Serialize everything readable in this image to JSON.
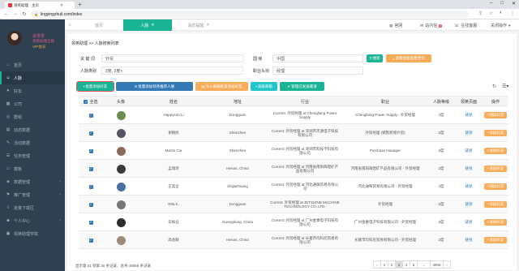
{
  "browser": {
    "tab_title": "领英助理 - 主页",
    "url": "lingyingzhuli.com/index",
    "new_tab": "+",
    "nav": {
      "back": "←",
      "forward": "→",
      "reload": "↻"
    },
    "window_buttons": [
      "–",
      "□",
      "✕"
    ]
  },
  "profile": {
    "name": "肖零零",
    "role": "领英助理全能",
    "vip": "VIP会员"
  },
  "sidebar": {
    "items": [
      {
        "label": "首页",
        "icon": "home-icon",
        "glyph": "⌂",
        "active": false,
        "arrow": false
      },
      {
        "label": "人脉",
        "icon": "people-icon",
        "glyph": "☺",
        "active": true,
        "arrow": false
      },
      {
        "label": "好友",
        "icon": "friend-icon",
        "glyph": "♥",
        "active": false,
        "arrow": false
      },
      {
        "label": "公司",
        "icon": "company-icon",
        "glyph": "▦",
        "active": false,
        "arrow": false
      },
      {
        "label": "群组",
        "icon": "group-icon",
        "glyph": "◎",
        "active": false,
        "arrow": false
      },
      {
        "label": "动态数据",
        "icon": "chart-icon",
        "glyph": "▤",
        "active": false,
        "arrow": false
      },
      {
        "label": "活动数据",
        "icon": "activity-icon",
        "glyph": "✎",
        "active": false,
        "arrow": false
      },
      {
        "label": "任务管理",
        "icon": "task-icon",
        "glyph": "☰",
        "active": false,
        "arrow": false
      },
      {
        "label": "模板",
        "icon": "template-icon",
        "glyph": "▭",
        "active": false,
        "arrow": false
      },
      {
        "label": "数据管理",
        "icon": "data-icon",
        "glyph": "◈",
        "active": false,
        "arrow": true
      },
      {
        "label": "推广管理",
        "icon": "promo-icon",
        "glyph": "⚑",
        "active": false,
        "arrow": true
      },
      {
        "label": "批量下载区",
        "icon": "download-icon",
        "glyph": "⇩",
        "active": false,
        "arrow": false
      },
      {
        "label": "个人中心",
        "icon": "user-icon",
        "glyph": "☻",
        "active": false,
        "arrow": true
      },
      {
        "label": "领英助理学院",
        "icon": "school-icon",
        "glyph": "▣",
        "active": false,
        "arrow": false
      }
    ]
  },
  "apptabs": {
    "left_arrow": "«",
    "home": "首页",
    "active": "人脉",
    "third": "消息提醒"
  },
  "topbar": {
    "website": "官网",
    "notice": "站内信",
    "notice_count": "7",
    "online": "在线客服",
    "more": "关闭操作"
  },
  "breadcrumb": "领英助理 >> 人脉搜索列表",
  "filters": {
    "keyword_label": "关 键 词",
    "keyword_value": "外贸",
    "relation_label": "人脉类别",
    "relation_value": "2度, 3度+",
    "country_label": "国    家",
    "country_value": "中国",
    "title_label": "职业头衔",
    "title_value": "经理",
    "search_btn": "搜索",
    "advanced_btn": "高级搜索查看更多"
  },
  "actions": [
    {
      "label": "批量添加好友",
      "color": "#1ab394",
      "icon": "▪"
    },
    {
      "label": "批量添加领英推荐人脉",
      "color": "#337ab7",
      "icon": "in"
    },
    {
      "label": "导入邮箱批量添加好友",
      "color": "#f8ac59",
      "icon": "▤"
    },
    {
      "label": "高级邮箱",
      "color": "#23c6c8",
      "icon": "▪"
    },
    {
      "label": "管理已发送邀请",
      "color": "#1ab394",
      "icon": "✔"
    }
  ],
  "tools": {
    "refresh": "↻",
    "columns": "☰▾"
  },
  "table": {
    "headers": [
      "全选",
      "头像",
      "姓名",
      "地址",
      "行业",
      "职业",
      "人脉等级",
      "领英页面",
      "操作"
    ],
    "rows": [
      {
        "name": "Happyson Li",
        "addr": "Dongguan",
        "industry": "Current: 外贸经理 at Chengliang Power Supply",
        "job": "Chengliang Power Supply - 外贸经理",
        "level": "2度",
        "page": "链接",
        "op": "添加好友",
        "av": "#6b8e4e"
      },
      {
        "name": "谢钢民",
        "addr": "Shenzhen",
        "industry": "Current: 外贸经理 at 深圳市杰源电子科技有限公司",
        "job": "外贸经理 (销售跨境外贸)",
        "level": "2度",
        "page": "链接",
        "op": "添加好友",
        "av": "#556"
      },
      {
        "name": "Martin Cai",
        "addr": "Shenzhen",
        "industry": "Current: 外贸经理 at 深圳市科技不科技有限公司",
        "job": "Purchase manager",
        "level": "2度",
        "page": "链接",
        "op": "添加好友",
        "av": "#8a6b5a"
      },
      {
        "name": "孟瑞玲",
        "addr": "Henan, China",
        "industry": "Current: 外贸经理 at 河南省南阳辉煌矿产品有限公司",
        "job": "河南省南阳辉煌矿产品有限公司 - 外贸经理",
        "level": "2度",
        "page": "链接",
        "op": "添加好友",
        "av": "#3a3a3a"
      },
      {
        "name": "王奕企",
        "addr": "Shijiazhuang",
        "industry": "Current: 外贸经理 at 河北通晖贸易有限公司",
        "job": "河北通晖贸易有限公司 - 外贸经理",
        "level": "2度",
        "page": "链接",
        "op": "添加好友",
        "av": "#4a6fa5"
      },
      {
        "name": "Rita K.",
        "addr": "Dongguan",
        "industry": "Current: 外贸经理 at JETSHINE MACHINE TECHNOLOGY CO.,LTD.",
        "job": "外贸经理",
        "level": "2度",
        "page": "链接",
        "op": "添加好友",
        "av": "#777"
      },
      {
        "name": "毕振业",
        "addr": "Guangdong, China",
        "industry": "Current: 外贸经理 at 广州金乘电子科技有限公司",
        "job": "广州金乘电子科技有限公司 - 外贸经理",
        "level": "2度",
        "page": "链接",
        "op": "添加好友",
        "av": "#2d2d2d"
      },
      {
        "name": "高会联",
        "addr": "Henan, China",
        "industry": "Current: 外贸经理 at 长葛市玛科尼贸易有限公司",
        "job": "长葛市玛科尼贸易有限公司 - 外贸经理",
        "level": "2度",
        "page": "链接",
        "op": "添加好友",
        "av": "#9c8a7a"
      }
    ]
  },
  "footer": {
    "summary": "显示第 21 到第 30 条记录，总共 48058 条记录",
    "pages": [
      "‹",
      "1",
      "2",
      "3",
      "4",
      "5",
      "...",
      "4806",
      "›"
    ],
    "active_page": "3"
  }
}
